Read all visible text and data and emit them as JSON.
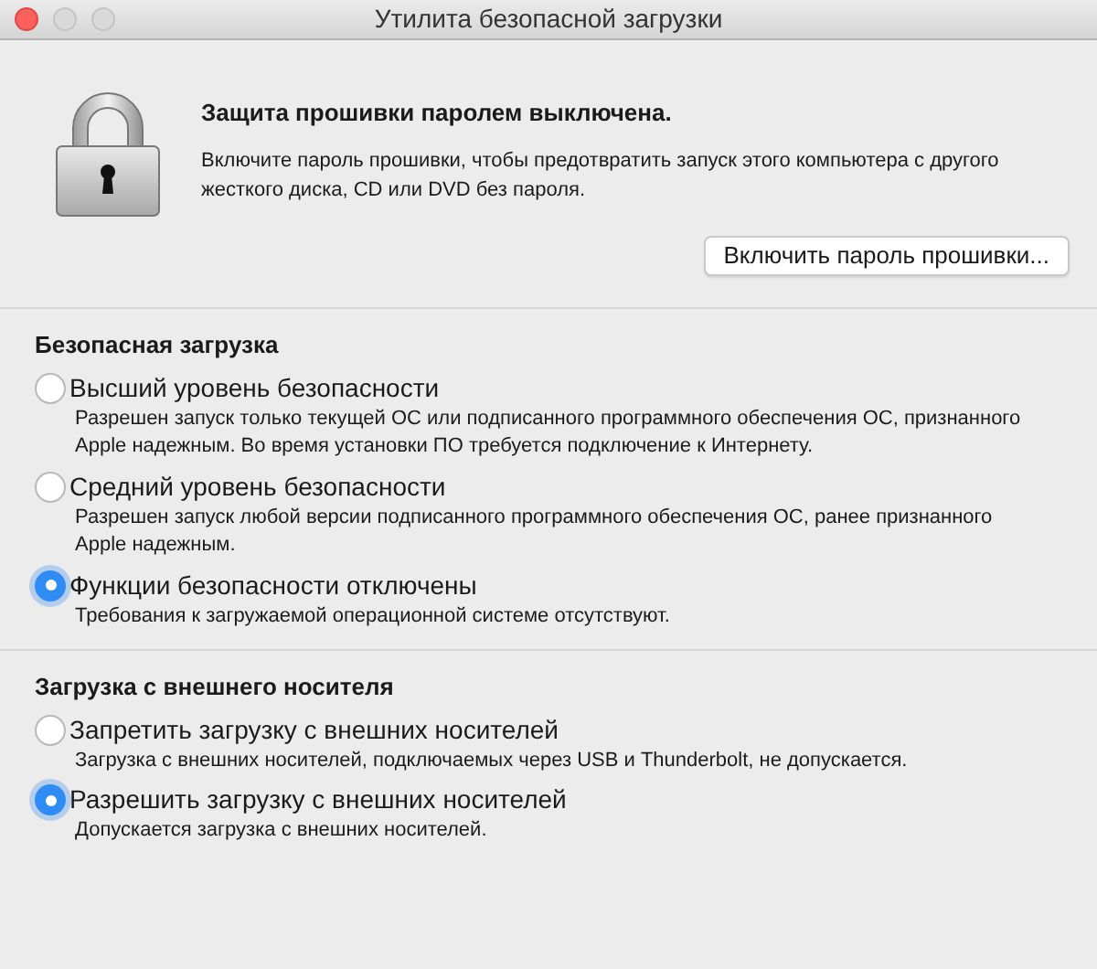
{
  "window": {
    "title": "Утилита безопасной загрузки"
  },
  "firmware": {
    "heading": "Защита прошивки паролем выключена.",
    "description": "Включите пароль прошивки, чтобы предотвратить запуск этого компьютера с другого жесткого диска, CD или DVD без пароля.",
    "button": "Включить пароль прошивки..."
  },
  "sections": [
    {
      "title": "Безопасная загрузка",
      "options": [
        {
          "label": "Высший уровень безопасности",
          "description": "Разрешен запуск только текущей ОС или подписанного программного обеспечения ОС, признанного Apple надежным. Во время установки ПО требуется подключение к Интернету.",
          "selected": false
        },
        {
          "label": "Средний уровень безопасности",
          "description": "Разрешен запуск любой версии подписанного программного обеспечения ОС, ранее признанного Apple надежным.",
          "selected": false
        },
        {
          "label": "Функции безопасности отключены",
          "description": "Требования к загружаемой операционной системе отсутствуют.",
          "selected": true
        }
      ]
    },
    {
      "title": "Загрузка с внешнего носителя",
      "options": [
        {
          "label": "Запретить загрузку с внешних носителей",
          "description": "Загрузка с внешних носителей, подключаемых через USB и Thunderbolt, не допускается.",
          "selected": false
        },
        {
          "label": "Разрешить загрузку с внешних носителей",
          "description": "Допускается загрузка с внешних носителей.",
          "selected": true
        }
      ]
    }
  ]
}
